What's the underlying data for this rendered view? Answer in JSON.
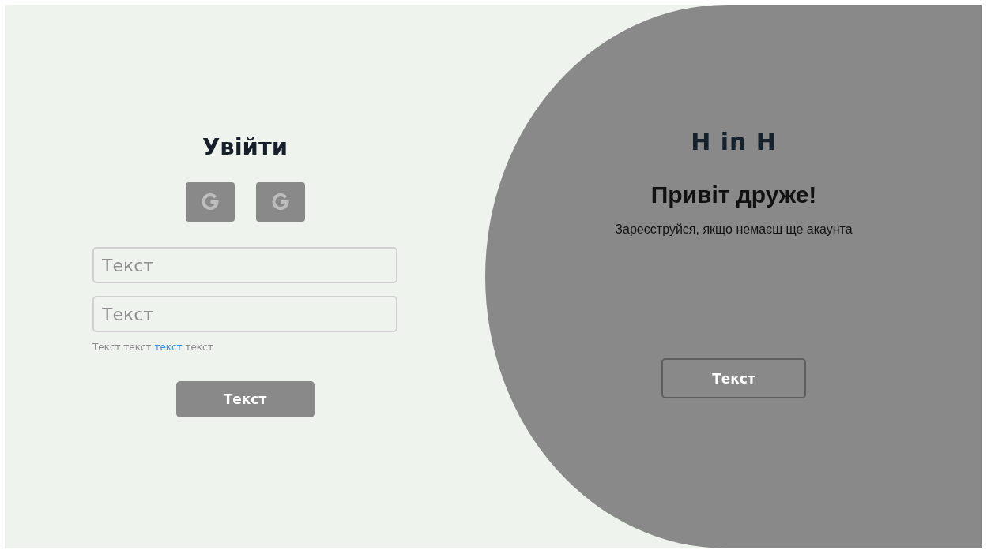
{
  "login": {
    "title": "Увійти",
    "social_buttons": [
      {
        "kind": "google"
      },
      {
        "kind": "google"
      }
    ],
    "fields": [
      {
        "placeholder": "Текст"
      },
      {
        "placeholder": "Текст"
      }
    ],
    "hint": {
      "before": "Текст текст",
      "link": "текст",
      "after": "текст"
    },
    "submit": "Текст"
  },
  "welcome": {
    "logo": "H in H",
    "title": "Привіт друже!",
    "subtitle": "Зареєструйся, якщо немаєш ще акаунта",
    "button": "Текст"
  }
}
